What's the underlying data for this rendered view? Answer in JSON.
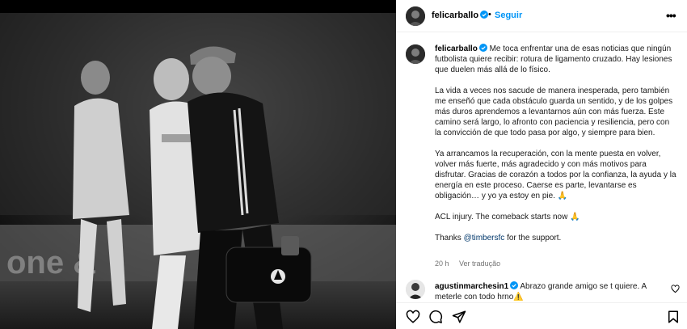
{
  "post": {
    "username": "felicarballo",
    "follow_label": "Seguir",
    "separator": "•",
    "more_label": "•••",
    "caption_paragraphs": [
      "Me toca enfrentar una de esas noticias que ningún futbolista quiere recibir: rotura de ligamento cruzado. Hay lesiones que duelen más allá de lo físico.",
      "La vida a veces nos sacude de manera inesperada, pero también me enseñó que cada obstáculo guarda un sentido, y de los golpes más duros aprendemos a levantarnos aún con más fuerza. Este camino será largo, lo afronto con paciencia y resiliencia, pero con la convicción de que todo pasa por algo, y siempre para bien.",
      "Ya arrancamos la recuperación, con la mente puesta en volver, volver más fuerte, más agradecido y con más motivos para disfrutar. Gracias de corazón a todos por la confianza, la ayuda y la energía en este proceso. Caerse es parte, levantarse es obligación… y yo ya estoy en pie. 🙏",
      "ACL injury. The comeback starts now 🙏"
    ],
    "thanks_prefix": "Thanks ",
    "thanks_mention": "@timbersfc",
    "thanks_suffix": " for the support.",
    "time_ago": "20 h",
    "translate_label": "Ver tradução"
  },
  "comment": {
    "username": "agustinmarchesin1",
    "text": "Abrazo grande amigo se t quiere. A meterle con todo hrno⚠️"
  },
  "icons": {
    "verified": "verified-badge-icon",
    "like": "heart-icon",
    "comment": "comment-bubble-icon",
    "share": "paper-plane-icon",
    "save": "bookmark-icon"
  },
  "colors": {
    "accent": "#0095f6",
    "verified": "#0095f6",
    "muted": "#737373",
    "mention": "#00376b"
  }
}
